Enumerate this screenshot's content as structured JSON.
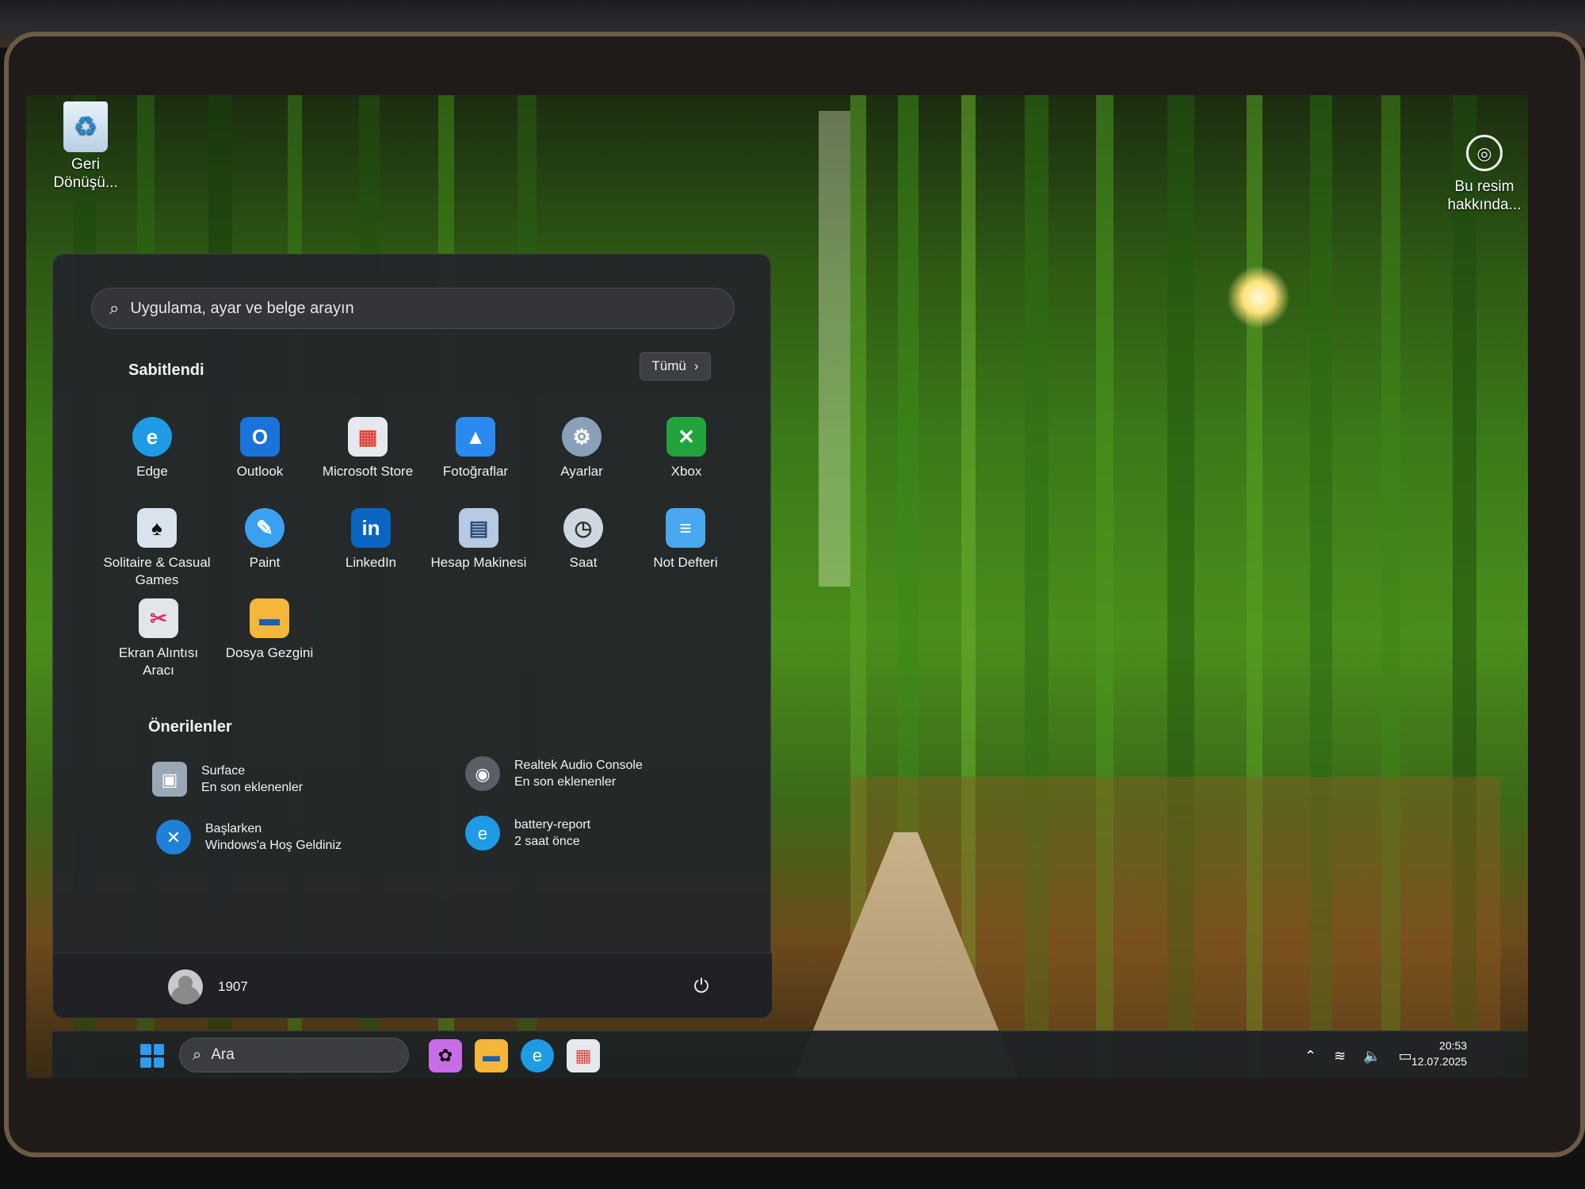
{
  "desktop": {
    "recycle_bin_label": "Geri Dönüşü...",
    "about_picture_label": "Bu resim hakkında..."
  },
  "start_menu": {
    "search_placeholder": "Uygulama, ayar ve belge arayın",
    "pinned_title": "Sabitlendi",
    "all_label": "Tümü",
    "pinned_apps": [
      {
        "label": "Edge",
        "icon": "edge-icon",
        "color": "#1f9be6"
      },
      {
        "label": "Outlook",
        "icon": "outlook-icon",
        "color": "#1a73d9"
      },
      {
        "label": "Microsoft Store",
        "icon": "microsoft-store-icon",
        "color": "#e5e8ec"
      },
      {
        "label": "Fotoğraflar",
        "icon": "photos-icon",
        "color": "#2a8af0"
      },
      {
        "label": "Ayarlar",
        "icon": "settings-gear-icon",
        "color": "#8aa0b8"
      },
      {
        "label": "Xbox",
        "icon": "xbox-icon",
        "color": "#22a33c"
      },
      {
        "label": "Solitaire & Casual Games",
        "icon": "solitaire-icon",
        "color": "#d9e3ec"
      },
      {
        "label": "Paint",
        "icon": "paint-icon",
        "color": "#3aa0f0"
      },
      {
        "label": "LinkedIn",
        "icon": "linkedin-icon",
        "color": "#0a66c2"
      },
      {
        "label": "Hesap Makinesi",
        "icon": "calculator-icon",
        "color": "#b7c9e3"
      },
      {
        "label": "Saat",
        "icon": "clock-icon",
        "color": "#cfd7e0"
      },
      {
        "label": "Not Defteri",
        "icon": "notepad-icon",
        "color": "#4aa8f0"
      },
      {
        "label": "Ekran Alıntısı Aracı",
        "icon": "snipping-tool-icon",
        "color": "#e2e6ea"
      },
      {
        "label": "Dosya Gezgini",
        "icon": "file-explorer-icon",
        "color": "#f4b73a"
      }
    ],
    "recommended_title": "Önerilenler",
    "recommended": [
      {
        "title": "Surface",
        "subtitle": "En son eklenenler",
        "icon": "surface-icon",
        "color": "#9aa7b5"
      },
      {
        "title": "Realtek Audio Console",
        "subtitle": "En son eklenenler",
        "icon": "realtek-audio-icon",
        "color": "#5a5f66"
      },
      {
        "title": "Başlarken",
        "subtitle": "Windows'a Hoş Geldiniz",
        "icon": "get-started-icon",
        "color": "#1f80d8"
      },
      {
        "title": "battery-report",
        "subtitle": "2 saat önce",
        "icon": "edge-document-icon",
        "color": "#1f9be6"
      }
    ],
    "user_name": "1907"
  },
  "taskbar": {
    "search_placeholder": "Ara",
    "pinned": [
      {
        "icon": "copilot-icon",
        "color": "#c86de6"
      },
      {
        "icon": "file-explorer-icon",
        "color": "#f4b73a"
      },
      {
        "icon": "edge-icon",
        "color": "#1f9be6"
      },
      {
        "icon": "microsoft-store-icon",
        "color": "#e5e8ec"
      }
    ],
    "time": "20:53",
    "date": "12.07.2025"
  },
  "colors": {
    "accent": "#2b9cf0",
    "menu_background": "#24262a"
  }
}
